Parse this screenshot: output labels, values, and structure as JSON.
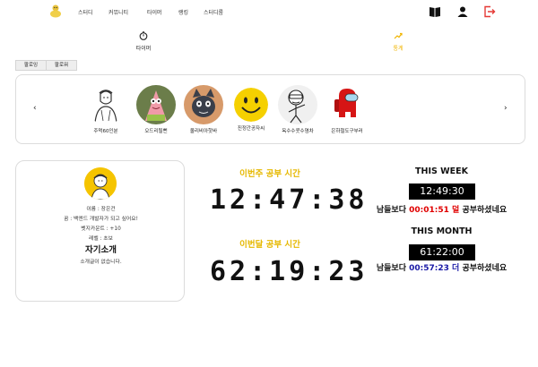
{
  "nav": {
    "items": [
      "스터디",
      "커뮤니티",
      "타이머",
      "랭킹",
      "스터디룸"
    ],
    "icons": [
      "book-icon",
      "user-icon",
      "logout-icon"
    ],
    "logout_color": "#e53935"
  },
  "tabs": {
    "timer": "타이머",
    "stats": "통계",
    "accent": "#f0b400"
  },
  "follow": {
    "following": "팔로잉",
    "follower": "팔로워"
  },
  "carousel": {
    "prev": "‹",
    "next": "›",
    "users": [
      {
        "name": "주먹60인분",
        "icon": "sketch-person-icon"
      },
      {
        "name": "오드리될뻔",
        "icon": "patrick-icon"
      },
      {
        "name": "올리비아핫바",
        "icon": "cat-icon"
      },
      {
        "name": "진정간공자씨",
        "icon": "smiley-icon"
      },
      {
        "name": "옥수수콧수염차",
        "icon": "stick-figure-icon"
      },
      {
        "name": "은하철도구부러",
        "icon": "among-us-icon"
      }
    ]
  },
  "profile": {
    "name_line": "이름 : 장은건",
    "dream_line": "꿈 : 백엔드 개발자가 되고 싶어요!",
    "badge_line": "벳지카운트 : +10",
    "level_line": "레벨 : 초보",
    "intro_title": "자기소개",
    "intro_text": "소개글이 없습니다."
  },
  "study": {
    "week_label": "이번주 공부 시간",
    "week_time": "12:47:38",
    "month_label": "이번달 공부 시간",
    "month_time": "62:19:23",
    "label_color": "#e6b800"
  },
  "compare": {
    "week_title": "THIS WEEK",
    "week_time": "12:49:30",
    "week_prefix": "남들보다",
    "week_diff": "00:01:51 덜",
    "week_suffix": "공부하셨네요",
    "month_title": "THIS MONTH",
    "month_time": "61:22:00",
    "month_prefix": "남들보다",
    "month_diff": "00:57:23 더",
    "month_suffix": "공부하셨네요",
    "less_color": "#e00000",
    "more_color": "#1a1aa6"
  }
}
